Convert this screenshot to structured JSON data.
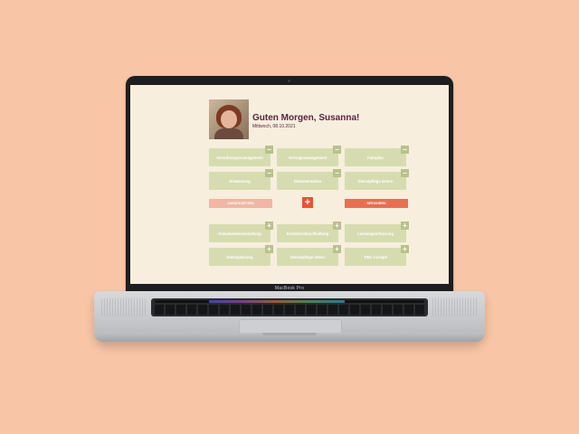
{
  "device": {
    "label": "MacBook Pro"
  },
  "header": {
    "greeting": "Guten Morgen, Susanna!",
    "date": "Mittwoch, 08.10.2021"
  },
  "active_tiles": [
    {
      "label": "Verordnungsmanagement",
      "badge": "−"
    },
    {
      "label": "Vertragsmanagement",
      "badge": "−"
    },
    {
      "label": "Fahrplan",
      "badge": "−"
    },
    {
      "label": "Einweisung",
      "badge": "−"
    },
    {
      "label": "Dokumentation",
      "badge": "−"
    },
    {
      "label": "Dienstpflege extern",
      "badge": "−"
    }
  ],
  "actions": {
    "reset_label": "ZURÜCKSETZEN",
    "add_symbol": "+",
    "save_label": "SPEICHERN"
  },
  "available_tiles": [
    {
      "label": "Dokumentenverwaltung",
      "badge": "+"
    },
    {
      "label": "Kreditorenbuchhaltung",
      "badge": "+"
    },
    {
      "label": "Leistungserfassung",
      "badge": "+"
    },
    {
      "label": "Dienstplanung",
      "badge": "+"
    },
    {
      "label": "Dienstpflege intern",
      "badge": "+"
    },
    {
      "label": "TIBL-Cockpit",
      "badge": "+"
    }
  ],
  "colors": {
    "background": "#f8c5a6",
    "screen": "#f7eedd",
    "tile": "#d6dcb0",
    "tile_badge": "#b9c28a",
    "heading": "#5b2340",
    "save": "#e96f52",
    "reset": "#f1b6a4",
    "add": "#e8532f"
  }
}
